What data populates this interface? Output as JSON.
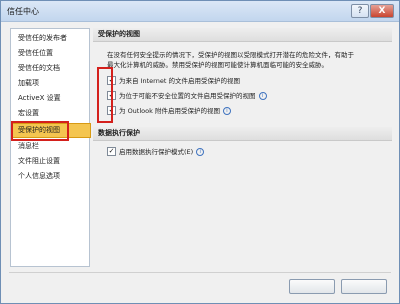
{
  "window": {
    "title": "信任中心",
    "help_label": "?",
    "close_label": "X"
  },
  "sidebar": {
    "items": [
      {
        "label": "受信任的发布者"
      },
      {
        "label": "受信任位置"
      },
      {
        "label": "受信任的文档"
      },
      {
        "label": "加载项"
      },
      {
        "label": "ActiveX 设置"
      },
      {
        "label": "宏设置"
      },
      {
        "label": "受保护的视图"
      },
      {
        "label": "消息栏"
      },
      {
        "label": "文件阻止设置"
      },
      {
        "label": "个人信息选项"
      }
    ],
    "selected": "受保护的视图"
  },
  "protected_view": {
    "heading": "受保护的视图",
    "description": [
      "在没有任何安全提示的情况下，受保护的视图以受限模式打开潜在的危险文件，有助于",
      "最大化计算机的威胁。禁用受保护的视图可能使计算机面临可能的安全威胁。"
    ],
    "options": [
      {
        "label": "为来自 Internet 的文件启用受保护的视图",
        "checked": true,
        "info": false
      },
      {
        "label": "为位于可能不安全位置的文件启用受保护的视图",
        "checked": true,
        "info": true
      },
      {
        "label": "为 Outlook 附件启用受保护的视图",
        "checked": true,
        "info": true
      }
    ]
  },
  "dep": {
    "heading": "数据执行保护",
    "option": {
      "label": "启用数据执行保护模式(E)",
      "checked": true,
      "info": true
    }
  },
  "icons": {
    "checkbox_check": "✓",
    "info": "i"
  },
  "colors": {
    "selected_bg": "#f4c550",
    "highlight_border": "#d4201c"
  }
}
